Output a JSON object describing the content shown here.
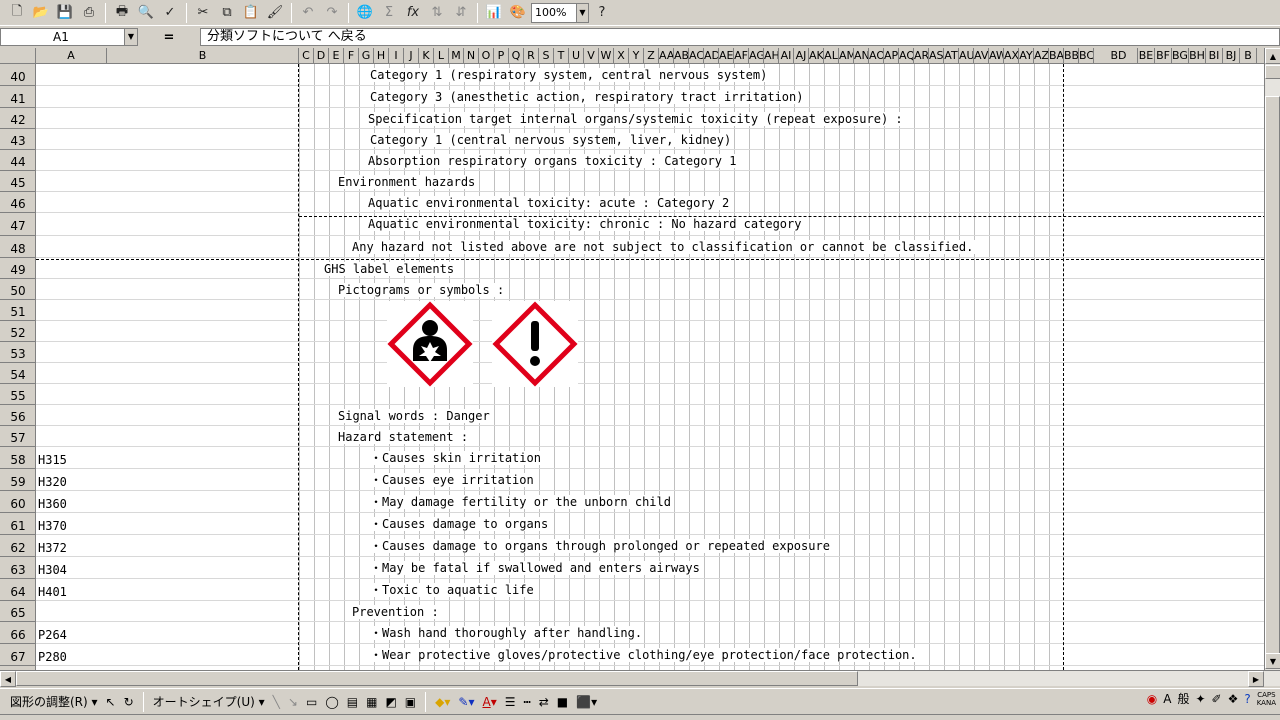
{
  "toolbar": {
    "zoom_value": "100%"
  },
  "formula_bar": {
    "name_box": "A1",
    "equals": "=",
    "content": "分類ソフトについて へ戻る"
  },
  "columns": {
    "a": "A",
    "b": "B",
    "narrow": [
      "C",
      "D",
      "E",
      "F",
      "G",
      "H",
      "I",
      "J",
      "K",
      "L",
      "M",
      "N",
      "O",
      "P",
      "Q",
      "R",
      "S",
      "T",
      "U",
      "V",
      "W",
      "X",
      "Y",
      "Z",
      "AA",
      "AB",
      "AC",
      "AD",
      "AE",
      "AF",
      "AG",
      "AH",
      "AI",
      "AJ",
      "AK",
      "AL",
      "AM",
      "AN",
      "AO",
      "AP",
      "AQ",
      "AR",
      "AS",
      "AT",
      "AU",
      "AV",
      "AW",
      "AX",
      "AY",
      "AZ",
      "BA",
      "BB",
      "BC"
    ],
    "bd": "BD",
    "tail": [
      "BE",
      "BF",
      "BG",
      "BH",
      "BI",
      "BJ",
      "B"
    ]
  },
  "rows": [
    "40",
    "41",
    "42",
    "43",
    "44",
    "45",
    "46",
    "47",
    "48",
    "49",
    "50",
    "51",
    "52",
    "53",
    "54",
    "55",
    "56",
    "57",
    "58",
    "59",
    "60",
    "61",
    "62",
    "63",
    "64",
    "65",
    "66",
    "67"
  ],
  "codes": {
    "r58": "H315",
    "r59": "H320",
    "r60": "H360",
    "r61": "H370",
    "r62": "H372",
    "r63": "H304",
    "r64": "H401",
    "r66": "P264",
    "r67": "P280"
  },
  "content": {
    "r40": "Category 1 (respiratory system, central nervous system)",
    "r41": "Category 3 (anesthetic action, respiratory tract irritation)",
    "r42": "Specification target internal organs/systemic toxicity (repeat exposure) :",
    "r43": "Category 1 (central nervous system, liver, kidney)",
    "r44": "Absorption respiratory organs toxicity : Category 1",
    "r45": "Environment hazards",
    "r46": "Aquatic environmental toxicity: acute : Category 2",
    "r47": "Aquatic environmental toxicity: chronic : No hazard category",
    "r48": "Any hazard not listed above are not subject to classification or cannot be classified.",
    "r49": "GHS label elements",
    "r50": "Pictograms or symbols :",
    "r56": "Signal words :   Danger",
    "r57": "Hazard statement :",
    "r58": "・Causes skin irritation",
    "r59": "・Causes eye irritation",
    "r60": "・May damage fertility or the unborn child",
    "r61": "・Causes damage to organs",
    "r62": "・Causes damage to organs through prolonged or repeated exposure",
    "r63": "・May be fatal if swallowed and enters airways",
    "r64": "・Toxic to aquatic life",
    "r65": "Prevention :",
    "r66": "・Wash hand thoroughly after handling.",
    "r67": "・Wear protective gloves/protective clothing/eye protection/face protection."
  },
  "pictograms": [
    "health-hazard",
    "exclamation-mark"
  ],
  "drawing_toolbar": {
    "draw_menu": "図形の調整(R)",
    "autoshape_menu": "オートシェイプ(U)"
  },
  "ime": {
    "mode": "A",
    "kanji": "般",
    "caps": "CAPS",
    "kana": "KANA"
  },
  "colors": {
    "pictogram_border": "#e0001a",
    "sheet_background": "#ffffff",
    "chrome": "#d4d0c8"
  }
}
